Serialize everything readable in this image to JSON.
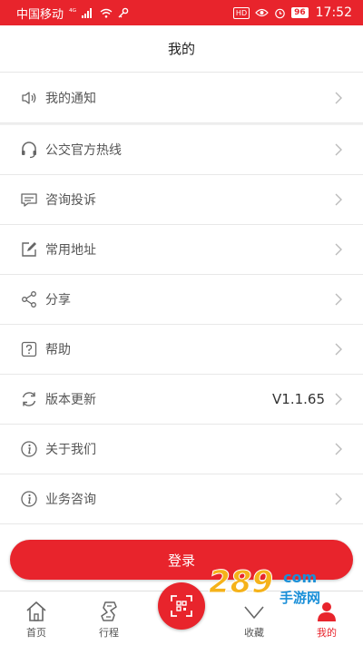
{
  "status_bar": {
    "carrier": "中国移动",
    "signal": "⁴ᴳ",
    "hd_badge": "HD",
    "battery": "96",
    "time": "17:52"
  },
  "header": {
    "title": "我的"
  },
  "menu_top": [
    {
      "label": "我的通知",
      "icon": "speaker-icon"
    }
  ],
  "menu": [
    {
      "label": "公交官方热线",
      "icon": "headset-icon",
      "value": ""
    },
    {
      "label": "咨询投诉",
      "icon": "message-icon",
      "value": ""
    },
    {
      "label": "常用地址",
      "icon": "edit-icon",
      "value": ""
    },
    {
      "label": "分享",
      "icon": "share-icon",
      "value": ""
    },
    {
      "label": "帮助",
      "icon": "help-icon",
      "value": ""
    },
    {
      "label": "版本更新",
      "icon": "refresh-icon",
      "value": "V1.1.65"
    },
    {
      "label": "关于我们",
      "icon": "info-icon",
      "value": ""
    },
    {
      "label": "业务咨询",
      "icon": "info-icon",
      "value": ""
    }
  ],
  "login_button": "登录",
  "tabbar": {
    "tabs": [
      {
        "label": "首页",
        "icon": "home-icon"
      },
      {
        "label": "行程",
        "icon": "route-icon"
      },
      {
        "label": "",
        "icon": "scan-icon"
      },
      {
        "label": "收藏",
        "icon": "favorite-icon"
      },
      {
        "label": "我的",
        "icon": "person-icon"
      }
    ],
    "active": "我的"
  },
  "watermark": {
    "text_main": "289",
    "text_sub": "手游网",
    "domain": "com"
  },
  "colors": {
    "accent": "#e8242c",
    "divider": "#e8e8e8",
    "section_gap": "#f0f0f0"
  }
}
